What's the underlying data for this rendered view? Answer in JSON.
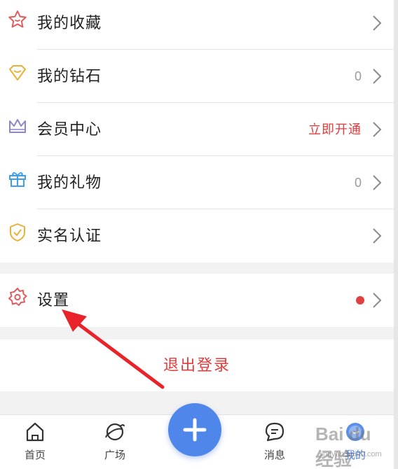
{
  "menu": {
    "items": [
      {
        "label": "我的收藏",
        "value": "",
        "icon": "star-icon"
      },
      {
        "label": "我的钻石",
        "value": "0",
        "icon": "diamond-icon"
      },
      {
        "label": "会员中心",
        "value": "立即开通",
        "icon": "crown-icon"
      },
      {
        "label": "我的礼物",
        "value": "0",
        "icon": "gift-icon"
      },
      {
        "label": "实名认证",
        "value": "",
        "icon": "shield-icon"
      }
    ]
  },
  "settings": {
    "label": "设置",
    "icon": "gear-icon",
    "has_badge": true
  },
  "logout": {
    "label": "退出登录"
  },
  "tabbar": {
    "tabs": [
      {
        "label": "首页",
        "icon": "home-icon"
      },
      {
        "label": "广场",
        "icon": "planet-icon"
      },
      {
        "label": "消息",
        "icon": "message-icon"
      },
      {
        "label": "我的",
        "icon": "profile-icon",
        "active": true
      }
    ],
    "fab_icon": "plus-icon"
  },
  "watermark": {
    "text": "Bai du 经验",
    "sub": "jingyan.baidu.com"
  },
  "colors": {
    "accent": "#4f86ea",
    "red": "#e33b3b",
    "arrow": "#e8232a"
  }
}
